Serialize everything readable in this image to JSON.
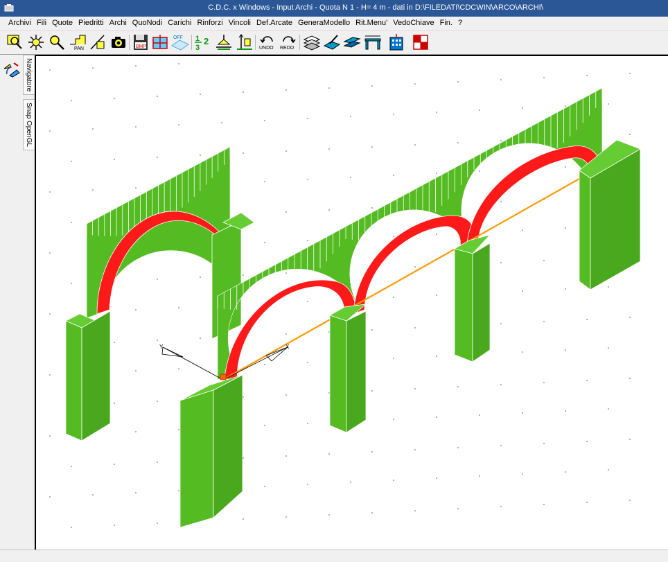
{
  "window": {
    "title": "C.D.C. x Windows - Input Archi - Quota N 1 - H= 4 m - dati in D:\\FILEDATI\\CDCWIN\\ARCO\\ARCHI\\"
  },
  "menu": {
    "items": [
      "Archivi",
      "Fili",
      "Quote",
      "Piedritti",
      "Archi",
      "QuoNodi",
      "Carichi",
      "Rinforzi",
      "Vincoli",
      "Def.Arcate",
      "GeneraModello",
      "Rit.Menu'",
      "VedoChiave",
      "Fin.",
      "?"
    ]
  },
  "toolbar": {
    "icons": [
      "zoom-window-icon",
      "snap-star-icon",
      "pick-icon",
      "pan-icon",
      "draw-icon",
      "camera-icon",
      "save-bmp-icon",
      "frame-icon",
      "off-icon",
      "fraction-icon",
      "support-icon",
      "vertical-load-icon",
      "undo-icon",
      "redo-icon",
      "layers-icon",
      "edit-icon",
      "slab-icon",
      "span-icon",
      "building-icon",
      "grid-icon"
    ],
    "labels": {
      "pan": "PAN",
      "bmp": "BMP",
      "off": "OFF",
      "undo": "UNDO",
      "redo": "REDO",
      "frac_a": "1",
      "frac_b": "3",
      "frac_c": "2"
    }
  },
  "sidebar": {
    "tabs": [
      "Navigatore",
      "Snap OpenGL"
    ]
  },
  "viewport": {
    "colors": {
      "pier": "#55bb22",
      "arch": "#ff1a1a",
      "tie": "#ff9900",
      "grid_dot": "#555555"
    },
    "axis_labels": [
      "X",
      "Y"
    ]
  }
}
